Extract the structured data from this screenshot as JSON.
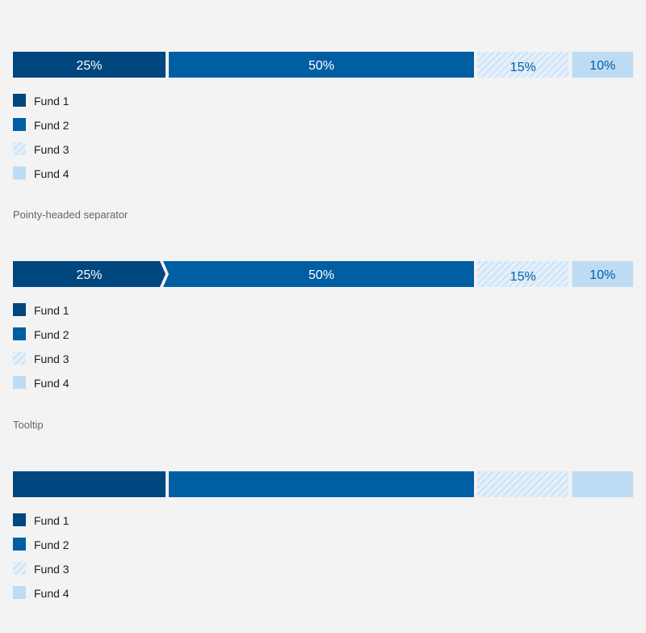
{
  "colors": {
    "fund1": "#00467f",
    "fund2": "#005ea2",
    "fund3_bg": "#e4f0fb",
    "fund3_stripe": "#cde2f5",
    "fund4": "#bddcf4",
    "dark_text": "#ffffff",
    "light_text": "#005ea2"
  },
  "chart_data": [
    {
      "type": "bar",
      "orientation": "horizontal-stacked",
      "separator": "straight",
      "show_labels": true,
      "categories": [
        "Fund 1",
        "Fund 2",
        "Fund 3",
        "Fund 4"
      ],
      "values": [
        25,
        50,
        15,
        10
      ],
      "labels": [
        "25%",
        "50%",
        "15%",
        "10%"
      ]
    },
    {
      "type": "bar",
      "orientation": "horizontal-stacked",
      "separator": "pointy",
      "show_labels": true,
      "categories": [
        "Fund 1",
        "Fund 2",
        "Fund 3",
        "Fund 4"
      ],
      "values": [
        25,
        50,
        15,
        10
      ],
      "labels": [
        "25%",
        "50%",
        "15%",
        "10%"
      ]
    },
    {
      "type": "bar",
      "orientation": "horizontal-stacked",
      "separator": "straight",
      "show_labels": false,
      "categories": [
        "Fund 1",
        "Fund 2",
        "Fund 3",
        "Fund 4"
      ],
      "values": [
        25,
        50,
        15,
        10
      ],
      "labels": []
    }
  ],
  "legends": [
    [
      "Fund 1",
      "Fund 2",
      "Fund 3",
      "Fund 4"
    ],
    [
      "Fund 1",
      "Fund 2",
      "Fund 3",
      "Fund 4"
    ],
    [
      "Fund 1",
      "Fund 2",
      "Fund 3",
      "Fund 4"
    ]
  ],
  "sections": {
    "pointy_label": "Pointy-headed separator",
    "tooltip_label": "Tooltip"
  }
}
